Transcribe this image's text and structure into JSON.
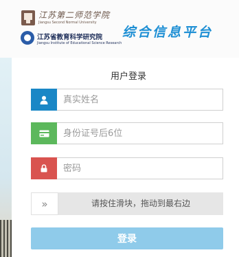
{
  "header": {
    "logo_jsnu": {
      "name_script": "江苏第二师范学院",
      "name_en": "Jiangsu Second Normal University"
    },
    "logo_jier": {
      "name_cn": "江苏省教育科学研究院",
      "name_en": "Jiangsu Institute of Educational Science Research"
    },
    "platform_title": "综合信息平台"
  },
  "login": {
    "title": "用户登录",
    "name_field": {
      "placeholder": "真实姓名",
      "icon": "user-icon"
    },
    "id_field": {
      "placeholder": "身份证号后6位",
      "icon": "id-card-icon"
    },
    "password_field": {
      "placeholder": "密码",
      "icon": "lock-icon"
    },
    "slider": {
      "handle_symbol": "»",
      "text": "请按住滑块，拖动到最右边"
    },
    "submit_label": "登录"
  },
  "colors": {
    "name_icon_bg": "#1a87c6",
    "id_icon_bg": "#5cb85c",
    "password_icon_bg": "#d9534f",
    "submit_bg": "#8fcbea",
    "title_color": "#1e8fd4"
  }
}
